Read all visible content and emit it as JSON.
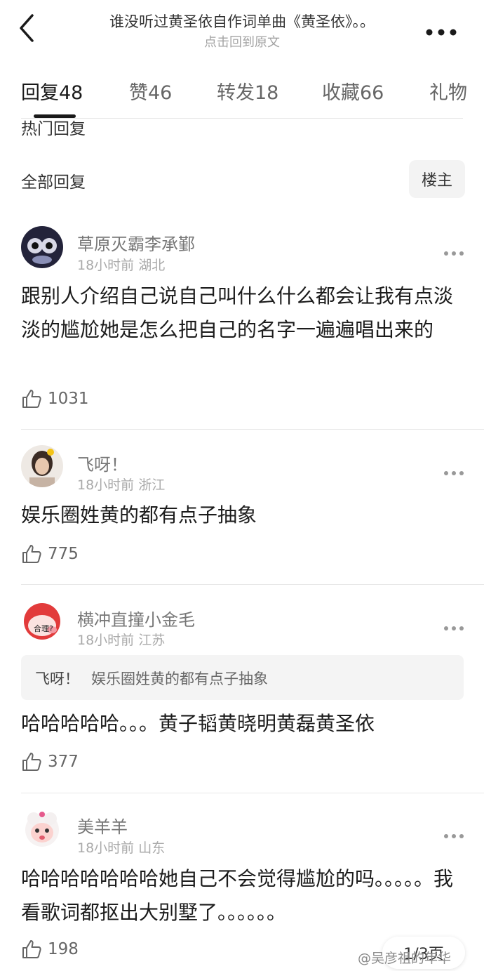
{
  "header": {
    "title": "谁没听过黄圣依自作词单曲《黄圣依》。。",
    "subtitle": "点击回到原文",
    "back_icon": "chevron-left-icon",
    "more_icon": "more-dots-icon"
  },
  "tabs": [
    {
      "label": "回复",
      "count": "48",
      "active": true
    },
    {
      "label": "赞",
      "count": "46",
      "active": false
    },
    {
      "label": "转发",
      "count": "18",
      "active": false
    },
    {
      "label": "收藏",
      "count": "66",
      "active": false
    },
    {
      "label": "礼物",
      "count": "",
      "active": false
    }
  ],
  "sections": {
    "hot": "热门回复",
    "all": "全部回复",
    "filter_button": "楼主"
  },
  "comments": [
    {
      "user": "草原灭霸李承鄞",
      "time": "18小时前",
      "location": "湖北",
      "text": "跟别人介绍自己说自己叫什么什么都会让我有点淡淡的尴尬她是怎么把自己的名字一遍遍唱出来的",
      "likes": "1031"
    },
    {
      "user": "飞呀！",
      "time": "18小时前",
      "location": "浙江",
      "text": "娱乐圈姓黄的都有点子抽象",
      "likes": "775"
    },
    {
      "user": "横冲直撞小金毛",
      "time": "18小时前",
      "location": "江苏",
      "quote_user": "飞呀！",
      "quote_text": "娱乐圈姓黄的都有点子抽象",
      "text": "哈哈哈哈哈。。。黄子韬黄晓明黄磊黄圣依",
      "likes": "377",
      "avatar_text": "合理?"
    },
    {
      "user": "美羊羊",
      "time": "18小时前",
      "location": "山东",
      "text": "哈哈哈哈哈哈哈她自己不会觉得尴尬的吗。。。。。我看歌词都抠出大别墅了。。。。。。",
      "likes": "198"
    }
  ],
  "footer": {
    "page_indicator": "1/3页",
    "watermark": "@吴彦祖的年华"
  },
  "colors": {
    "text_primary": "#1c1c1c",
    "text_secondary": "#777777",
    "meta": "#aaaaaa",
    "quote_bg": "#f4f4f4"
  }
}
